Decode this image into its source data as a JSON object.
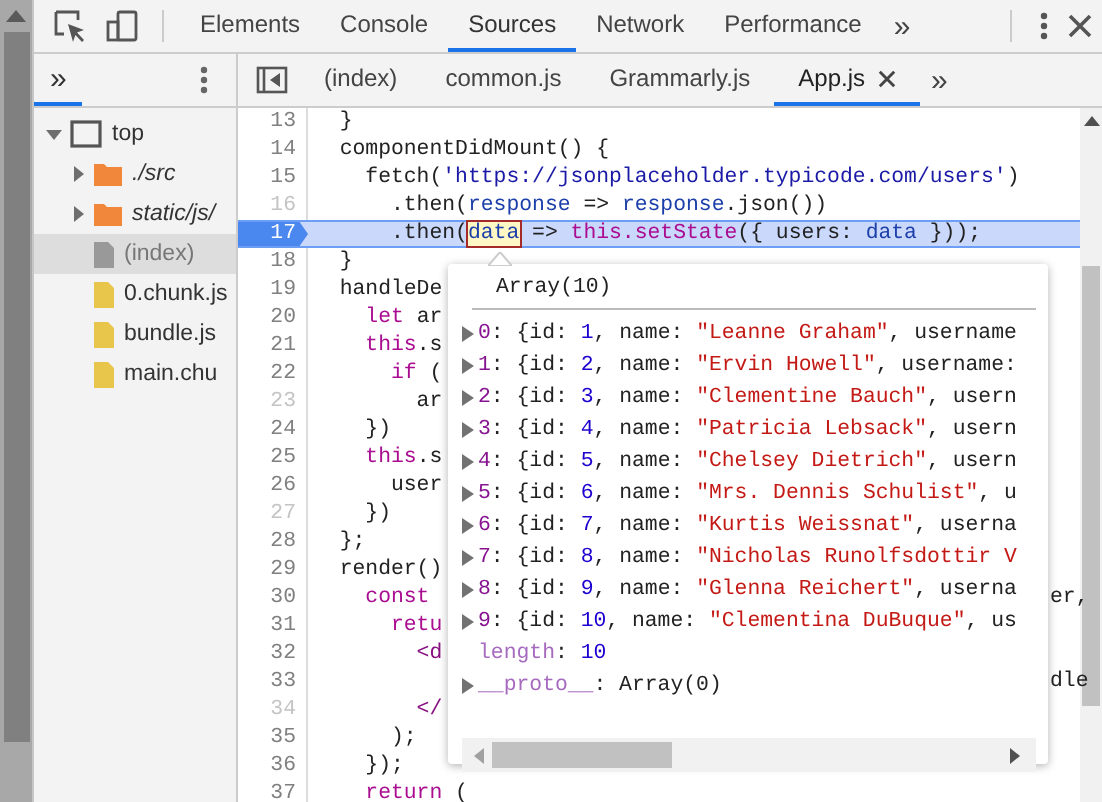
{
  "toolbar": {
    "tabs": [
      {
        "label": "Elements",
        "selected": false
      },
      {
        "label": "Console",
        "selected": false
      },
      {
        "label": "Sources",
        "selected": true
      },
      {
        "label": "Network",
        "selected": false
      },
      {
        "label": "Performance",
        "selected": false
      }
    ],
    "more": "»"
  },
  "navigator": {
    "more": "»",
    "tree": [
      {
        "label": "top",
        "kind": "frame",
        "expanded": true,
        "selected": false,
        "children": [
          {
            "label": "./src",
            "kind": "folder",
            "expanded": false,
            "selected": false
          },
          {
            "label": "static/js/",
            "kind": "folder",
            "expanded": false,
            "selected": false
          },
          {
            "label": "(index)",
            "kind": "document",
            "selected": true
          },
          {
            "label": "0.chunk.js",
            "kind": "script",
            "selected": false
          },
          {
            "label": "bundle.js",
            "kind": "script",
            "selected": false
          },
          {
            "label": "main.chu",
            "kind": "script",
            "selected": false
          }
        ]
      }
    ]
  },
  "editor_tabs": {
    "tabs": [
      {
        "label": "(index)",
        "selected": false
      },
      {
        "label": "common.js",
        "selected": false
      },
      {
        "label": "Grammarly.js",
        "selected": false
      },
      {
        "label": "App.js",
        "selected": true
      }
    ],
    "more": "»"
  },
  "code": {
    "lines": [
      {
        "number": "13",
        "muted": false,
        "paused": false,
        "tokens": [
          {
            "text": "  }",
            "kind": "plain"
          }
        ]
      },
      {
        "number": "14",
        "muted": false,
        "paused": false,
        "tokens": [
          {
            "text": "  componentDidMount() {",
            "kind": "plain"
          }
        ]
      },
      {
        "number": "15",
        "muted": false,
        "paused": false,
        "tokens": [
          {
            "text": "    fetch(",
            "kind": "plain"
          },
          {
            "text": "'https://jsonplaceholder.typicode.com/users'",
            "kind": "string"
          },
          {
            "text": ")",
            "kind": "plain"
          }
        ]
      },
      {
        "number": "16",
        "muted": true,
        "paused": false,
        "tokens": [
          {
            "text": "      .then(",
            "kind": "plain"
          },
          {
            "text": "response",
            "kind": "variable"
          },
          {
            "text": " => ",
            "kind": "plain"
          },
          {
            "text": "response",
            "kind": "variable"
          },
          {
            "text": ".json())",
            "kind": "plain"
          }
        ]
      },
      {
        "number": "17",
        "muted": false,
        "paused": true,
        "tokens": [
          {
            "text": "      .then(",
            "kind": "plain"
          },
          {
            "text": "data",
            "kind": "hover"
          },
          {
            "text": " => ",
            "kind": "plain"
          },
          {
            "text": "this.setState",
            "kind": "keyword"
          },
          {
            "text": "({ users: ",
            "kind": "plain"
          },
          {
            "text": "data",
            "kind": "variable"
          },
          {
            "text": " }));",
            "kind": "plain"
          }
        ]
      },
      {
        "number": "18",
        "muted": false,
        "paused": false,
        "tokens": [
          {
            "text": "  }",
            "kind": "plain"
          }
        ]
      },
      {
        "number": "19",
        "muted": false,
        "paused": false,
        "tokens": [
          {
            "text": "  handleDe",
            "kind": "plain"
          }
        ]
      },
      {
        "number": "20",
        "muted": false,
        "paused": false,
        "tokens": [
          {
            "text": "    let",
            "kind": "keyword"
          },
          {
            "text": " ar",
            "kind": "plain"
          }
        ]
      },
      {
        "number": "21",
        "muted": false,
        "paused": false,
        "tokens": [
          {
            "text": "    this",
            "kind": "keyword"
          },
          {
            "text": ".s",
            "kind": "plain"
          }
        ]
      },
      {
        "number": "22",
        "muted": false,
        "paused": false,
        "tokens": [
          {
            "text": "      if",
            "kind": "keyword"
          },
          {
            "text": " (",
            "kind": "plain"
          }
        ]
      },
      {
        "number": "23",
        "muted": true,
        "paused": false,
        "tokens": [
          {
            "text": "        ar",
            "kind": "plain"
          }
        ]
      },
      {
        "number": "24",
        "muted": false,
        "paused": false,
        "tokens": [
          {
            "text": "    })",
            "kind": "plain"
          }
        ]
      },
      {
        "number": "25",
        "muted": false,
        "paused": false,
        "tokens": [
          {
            "text": "    this",
            "kind": "keyword"
          },
          {
            "text": ".s",
            "kind": "plain"
          }
        ]
      },
      {
        "number": "26",
        "muted": false,
        "paused": false,
        "tokens": [
          {
            "text": "      user",
            "kind": "plain"
          }
        ]
      },
      {
        "number": "27",
        "muted": true,
        "paused": false,
        "tokens": [
          {
            "text": "    })",
            "kind": "plain"
          }
        ]
      },
      {
        "number": "28",
        "muted": false,
        "paused": false,
        "tokens": [
          {
            "text": "  };",
            "kind": "plain"
          }
        ]
      },
      {
        "number": "29",
        "muted": false,
        "paused": false,
        "tokens": [
          {
            "text": "  render()",
            "kind": "plain"
          }
        ]
      },
      {
        "number": "30",
        "muted": false,
        "paused": false,
        "tokens": [
          {
            "text": "    const",
            "kind": "keyword"
          }
        ],
        "tail": "er,"
      },
      {
        "number": "31",
        "muted": false,
        "paused": false,
        "tokens": [
          {
            "text": "      retu",
            "kind": "keyword"
          }
        ]
      },
      {
        "number": "32",
        "muted": false,
        "paused": false,
        "tokens": [
          {
            "text": "        <d",
            "kind": "tag"
          }
        ]
      },
      {
        "number": "33",
        "muted": false,
        "paused": false,
        "tail": "dle"
      },
      {
        "number": "34",
        "muted": true,
        "paused": false,
        "tokens": [
          {
            "text": "        </",
            "kind": "tag"
          }
        ]
      },
      {
        "number": "35",
        "muted": false,
        "paused": false,
        "tokens": [
          {
            "text": "      );",
            "kind": "plain"
          }
        ]
      },
      {
        "number": "36",
        "muted": false,
        "paused": false,
        "tokens": [
          {
            "text": "    });",
            "kind": "plain"
          }
        ]
      },
      {
        "number": "37",
        "muted": false,
        "paused": false,
        "tokens": [
          {
            "text": "    return",
            "kind": "keyword"
          },
          {
            "text": " (",
            "kind": "plain"
          }
        ]
      }
    ]
  },
  "popover": {
    "title": "Array(10)",
    "rows": [
      {
        "expandable": true,
        "tokens": [
          {
            "text": "0",
            "kind": "key"
          },
          {
            "text": ": {id: ",
            "kind": "plain"
          },
          {
            "text": "1",
            "kind": "number"
          },
          {
            "text": ", name: ",
            "kind": "plain"
          },
          {
            "text": "\"Leanne Graham\"",
            "kind": "string"
          },
          {
            "text": ", username",
            "kind": "plain"
          }
        ]
      },
      {
        "expandable": true,
        "tokens": [
          {
            "text": "1",
            "kind": "key"
          },
          {
            "text": ": {id: ",
            "kind": "plain"
          },
          {
            "text": "2",
            "kind": "number"
          },
          {
            "text": ", name: ",
            "kind": "plain"
          },
          {
            "text": "\"Ervin Howell\"",
            "kind": "string"
          },
          {
            "text": ", username:",
            "kind": "plain"
          }
        ]
      },
      {
        "expandable": true,
        "tokens": [
          {
            "text": "2",
            "kind": "key"
          },
          {
            "text": ": {id: ",
            "kind": "plain"
          },
          {
            "text": "3",
            "kind": "number"
          },
          {
            "text": ", name: ",
            "kind": "plain"
          },
          {
            "text": "\"Clementine Bauch\"",
            "kind": "string"
          },
          {
            "text": ", usern",
            "kind": "plain"
          }
        ]
      },
      {
        "expandable": true,
        "tokens": [
          {
            "text": "3",
            "kind": "key"
          },
          {
            "text": ": {id: ",
            "kind": "plain"
          },
          {
            "text": "4",
            "kind": "number"
          },
          {
            "text": ", name: ",
            "kind": "plain"
          },
          {
            "text": "\"Patricia Lebsack\"",
            "kind": "string"
          },
          {
            "text": ", usern",
            "kind": "plain"
          }
        ]
      },
      {
        "expandable": true,
        "tokens": [
          {
            "text": "4",
            "kind": "key"
          },
          {
            "text": ": {id: ",
            "kind": "plain"
          },
          {
            "text": "5",
            "kind": "number"
          },
          {
            "text": ", name: ",
            "kind": "plain"
          },
          {
            "text": "\"Chelsey Dietrich\"",
            "kind": "string"
          },
          {
            "text": ", usern",
            "kind": "plain"
          }
        ]
      },
      {
        "expandable": true,
        "tokens": [
          {
            "text": "5",
            "kind": "key"
          },
          {
            "text": ": {id: ",
            "kind": "plain"
          },
          {
            "text": "6",
            "kind": "number"
          },
          {
            "text": ", name: ",
            "kind": "plain"
          },
          {
            "text": "\"Mrs. Dennis Schulist\"",
            "kind": "string"
          },
          {
            "text": ", u",
            "kind": "plain"
          }
        ]
      },
      {
        "expandable": true,
        "tokens": [
          {
            "text": "6",
            "kind": "key"
          },
          {
            "text": ": {id: ",
            "kind": "plain"
          },
          {
            "text": "7",
            "kind": "number"
          },
          {
            "text": ", name: ",
            "kind": "plain"
          },
          {
            "text": "\"Kurtis Weissnat\"",
            "kind": "string"
          },
          {
            "text": ", userna",
            "kind": "plain"
          }
        ]
      },
      {
        "expandable": true,
        "tokens": [
          {
            "text": "7",
            "kind": "key"
          },
          {
            "text": ": {id: ",
            "kind": "plain"
          },
          {
            "text": "8",
            "kind": "number"
          },
          {
            "text": ", name: ",
            "kind": "plain"
          },
          {
            "text": "\"Nicholas Runolfsdottir V",
            "kind": "string"
          }
        ]
      },
      {
        "expandable": true,
        "tokens": [
          {
            "text": "8",
            "kind": "key"
          },
          {
            "text": ": {id: ",
            "kind": "plain"
          },
          {
            "text": "9",
            "kind": "number"
          },
          {
            "text": ", name: ",
            "kind": "plain"
          },
          {
            "text": "\"Glenna Reichert\"",
            "kind": "string"
          },
          {
            "text": ", userna",
            "kind": "plain"
          }
        ]
      },
      {
        "expandable": true,
        "tokens": [
          {
            "text": "9",
            "kind": "key"
          },
          {
            "text": ": {id: ",
            "kind": "plain"
          },
          {
            "text": "10",
            "kind": "number"
          },
          {
            "text": ", name: ",
            "kind": "plain"
          },
          {
            "text": "\"Clementina DuBuque\"",
            "kind": "string"
          },
          {
            "text": ", us",
            "kind": "plain"
          }
        ]
      },
      {
        "expandable": false,
        "tokens": [
          {
            "text": "length",
            "kind": "meta"
          },
          {
            "text": ": ",
            "kind": "plain"
          },
          {
            "text": "10",
            "kind": "number"
          }
        ]
      },
      {
        "expandable": true,
        "tokens": [
          {
            "text": "__proto__",
            "kind": "meta"
          },
          {
            "text": ": Array(0)",
            "kind": "plain"
          }
        ]
      }
    ]
  }
}
